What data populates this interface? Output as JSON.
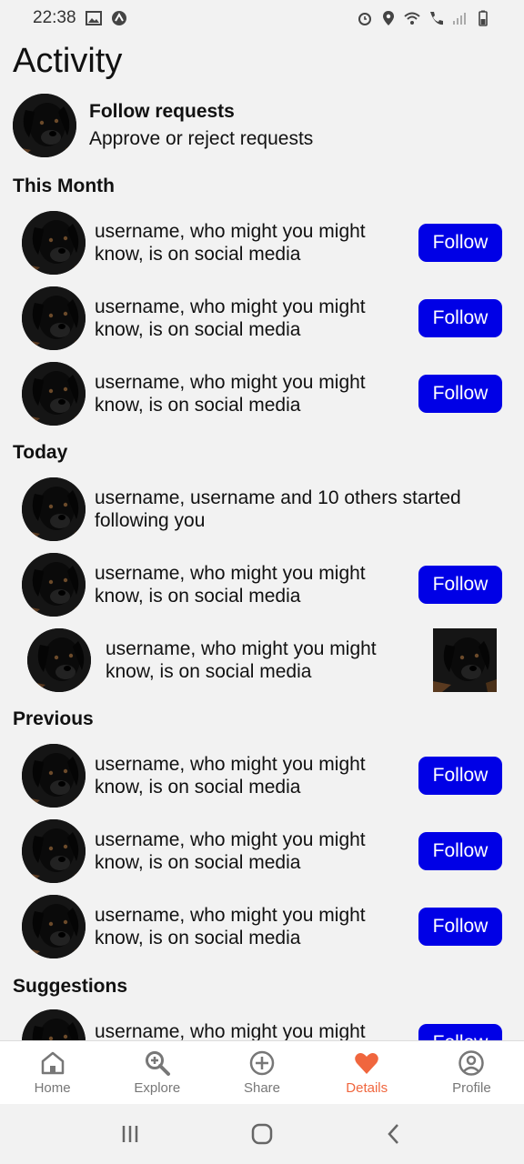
{
  "status_bar": {
    "time": "22:38"
  },
  "page": {
    "title": "Activity"
  },
  "follow_requests": {
    "title": "Follow requests",
    "subtitle": "Approve or reject requests"
  },
  "sections": {
    "this_month": "This Month",
    "today": "Today",
    "previous": "Previous",
    "suggestions": "Suggestions"
  },
  "rows": {
    "m1": {
      "text": "username, who might you might know, is on social media",
      "button": "Follow"
    },
    "m2": {
      "text": "username, who might you might know, is on social media",
      "button": "Follow"
    },
    "m3": {
      "text": "username, who might you might know, is on social media",
      "button": "Follow"
    },
    "t1": {
      "text": "username, username and 10 others started following you"
    },
    "t2": {
      "text": "username, who might you might know, is on social media",
      "button": "Follow"
    },
    "t3": {
      "text": "username, who might you might know, is on social media"
    },
    "p1": {
      "text": "username, who might you might know, is on social media",
      "button": "Follow"
    },
    "p2": {
      "text": "username, who might you might know, is on social media",
      "button": "Follow"
    },
    "p3": {
      "text": "username, who might you might know, is on social media",
      "button": "Follow"
    },
    "s1": {
      "text": "username, who might you might",
      "button": "Follow"
    }
  },
  "nav": {
    "home": "Home",
    "explore": "Explore",
    "share": "Share",
    "details": "Details",
    "profile": "Profile"
  },
  "colors": {
    "follow_button": "#0000e6",
    "active_nav": "#f0663e"
  }
}
